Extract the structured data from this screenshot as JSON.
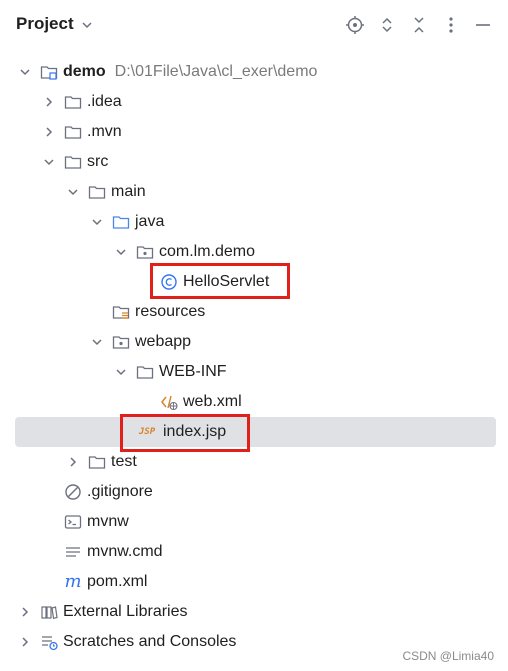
{
  "header": {
    "title": "Project"
  },
  "tree": {
    "root": {
      "label": "demo",
      "path": "D:\\01File\\Java\\cl_exer\\demo"
    },
    "idea": "idea",
    "mvn": "mvn",
    "src": "src",
    "main": "main",
    "java": "java",
    "package": "com.lm.demo",
    "hello_servlet": "HelloServlet",
    "resources": "resources",
    "webapp": "webapp",
    "web_inf": "WEB-INF",
    "web_xml": "web.xml",
    "index_jsp": "index.jsp",
    "test": "test",
    "gitignore": ".gitignore",
    "mvnw": "mvnw",
    "mvnw_cmd": "mvnw.cmd",
    "pom_xml": "pom.xml",
    "external_libraries": "External Libraries",
    "scratches": "Scratches and Consoles"
  },
  "icons": {
    "jsp_badge": "JSP"
  },
  "watermark": "CSDN @Limia40",
  "colors": {
    "highlight": "#e0201b",
    "selected_row": "#dfe1e5",
    "folder_blue": "#4a86e8",
    "class_blue": "#3574f0",
    "maven_blue": "#3574f0",
    "jsp_orange": "#d9822b",
    "path_gray": "#7a7a7a"
  }
}
